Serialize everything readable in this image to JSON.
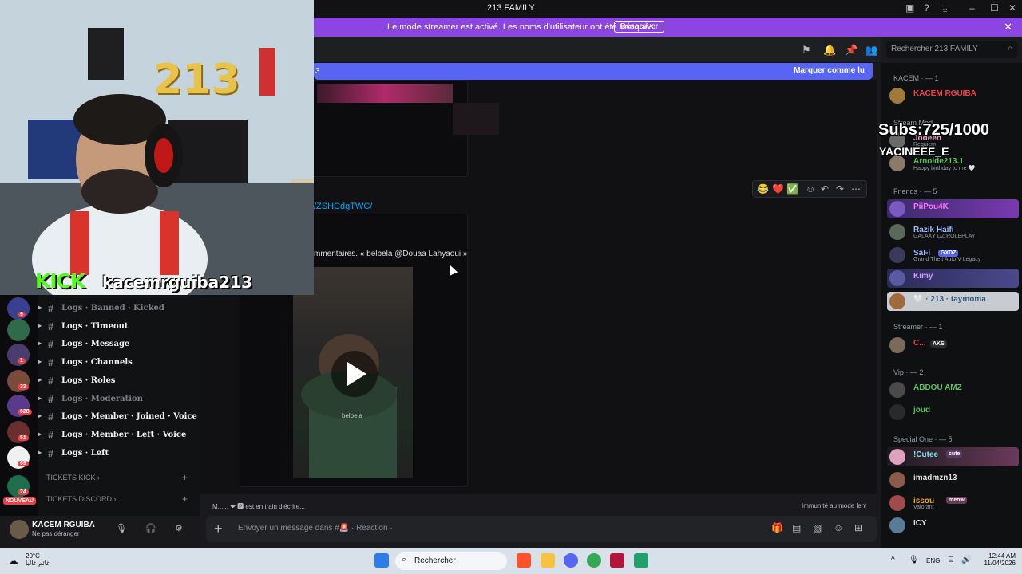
{
  "window": {
    "title": "213 FAMILY"
  },
  "banner": {
    "message": "Le mode streamer est activé. Les noms d'utilisateur ont été tronqués.",
    "button": "Désactiver"
  },
  "search": {
    "placeholder": "Rechercher 213 FAMILY"
  },
  "newbar": {
    "left": "3",
    "right": "Marquer comme lu"
  },
  "chat": {
    "link": "/ZSHCdgTWC/",
    "embed_text": "mmentaires. « belbela @Douaa Lahyaoui »",
    "video_label": "belbela",
    "typing": "M...... ❤ 🅿 est en train d'écrire...",
    "slowmode": "Immunité au mode lent",
    "composer_placeholder": "Envoyer un message dans #🚨 · Reaction ·"
  },
  "toolbar": {
    "emojis": [
      "😂",
      "❤️",
      "✅"
    ]
  },
  "overlay": {
    "kick": "KICK",
    "kick_user": "kacemrguiba213",
    "subs": "Subs:725/1000",
    "sub_user": "YACINEEE_E",
    "wall_text": "213"
  },
  "servers": [
    {
      "badge": "9",
      "color": "#3a3f8f"
    },
    {
      "badge": "",
      "color": "#2f6a4a"
    },
    {
      "badge": "1",
      "color": "#4b3d6b"
    },
    {
      "badge": "33",
      "color": "#7a4a3a"
    },
    {
      "badge": "628",
      "color": "#5a3a8a"
    },
    {
      "badge": "51",
      "color": "#6a2e2e"
    },
    {
      "badge": "69",
      "color": "#f0f0f0"
    },
    {
      "badge": "24",
      "color": "#1e6e4e"
    }
  ],
  "nouveau": "NOUVEAU",
  "channels": [
    {
      "label": "Logs · Banned · Kicked",
      "muted": true
    },
    {
      "label": "Logs · Timeout",
      "muted": false
    },
    {
      "label": "Logs · Message",
      "muted": false
    },
    {
      "label": "Logs · Channels",
      "muted": false
    },
    {
      "label": "Logs · Roles",
      "muted": false
    },
    {
      "label": "Logs · Moderation",
      "muted": true
    },
    {
      "label": "Logs · Member · Joined · Voice",
      "muted": false
    },
    {
      "label": "Logs · Member · Left · Voice",
      "muted": false
    },
    {
      "label": "Logs · Left",
      "muted": false
    }
  ],
  "categories": [
    "TICKETS KICK",
    "TICKETS DISCORD"
  ],
  "user": {
    "name": "KACEM RGUIBA",
    "status": "Ne pas déranger"
  },
  "members": {
    "groups": [
      {
        "label": "KACEM · — 1"
      },
      {
        "label": "Stream Mod"
      },
      {
        "label": "Friends · — 5"
      },
      {
        "label": "Streamer · — 1"
      },
      {
        "label": "Vip · — 2"
      },
      {
        "label": "Special One · — 5"
      }
    ],
    "list": [
      {
        "name": "KACEM RGUIBA",
        "sub": "",
        "color": "#f23f43",
        "av": "#a07a3a"
      },
      {
        "name": "Jodeen",
        "sub": "Requiem",
        "color": "#e9a0c0",
        "av": "#6a6a6a"
      },
      {
        "name": "Arnolde213.1",
        "sub": "Happy birthday to me 🤍",
        "color": "#57c15a",
        "av": "#8a7a6a"
      },
      {
        "name": "PiiPou4K",
        "sub": "",
        "color": "#ff73fa",
        "av": "#7a5ac0"
      },
      {
        "name": "Razik Haifi",
        "sub": "GALAXY DZ ROLEPLAY",
        "color": "#9fb9ff",
        "av": "#5a6a5a"
      },
      {
        "name": "SaFi",
        "sub": "Grand Theft Auto V Legacy",
        "color": "#9fb9ff",
        "av": "#3a3a5a"
      },
      {
        "name": "Kιmy",
        "sub": "",
        "color": "#d29bff",
        "av": "#5a5aa0"
      },
      {
        "name": "🤍 · 213 · taymoma",
        "sub": "",
        "color": "#3a5a7a",
        "av": "#a06a3a"
      },
      {
        "name": "C...",
        "sub": "",
        "color": "#f23f43",
        "av": "#7a6a5a"
      },
      {
        "name": "ABDOU AMZ",
        "sub": "",
        "color": "#57c15a",
        "av": "#4a4a4a"
      },
      {
        "name": "joud",
        "sub": "",
        "color": "#57c15a",
        "av": "#2a2a2a"
      },
      {
        "name": "!Cutee",
        "sub": "",
        "color": "#7ce0e0",
        "av": "#e0a0c0"
      },
      {
        "name": "imadmzn13",
        "sub": "",
        "color": "#dbdee1",
        "av": "#8a5a4a"
      },
      {
        "name": "issou",
        "sub": "Valorant",
        "color": "#f5a623",
        "av": "#a04a4a"
      },
      {
        "name": "ICY",
        "sub": "",
        "color": "#dbdee1",
        "av": "#5a7a9a"
      }
    ],
    "tags": {
      "safi": "GXDZ",
      "streamer": "AKS",
      "cutee": "cute",
      "issou": "meow"
    }
  },
  "taskbar": {
    "weather_temp": "20°C",
    "weather_desc": "غائم غالبا",
    "search": "Rechercher",
    "lang": "ENG",
    "time": "12:44 AM",
    "date": "11/04/2026"
  }
}
